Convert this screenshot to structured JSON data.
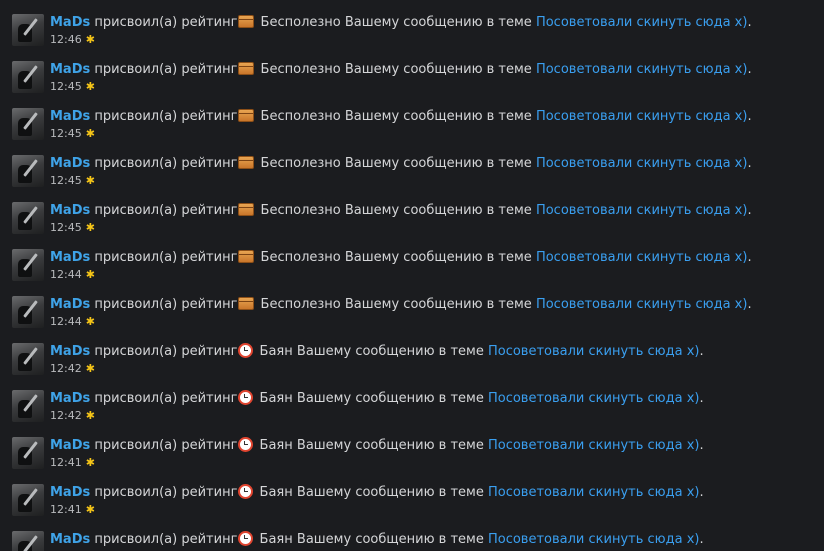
{
  "items": [
    {
      "user": "MaDs",
      "action": "присвоил(а) рейтинг",
      "rating_icon": "box-icon",
      "rating": "Бесполезно",
      "middle": "Вашему сообщению в теме",
      "thread": "Посоветовали скинуть сюда х)",
      "end": ".",
      "time": "12:46"
    },
    {
      "user": "MaDs",
      "action": "присвоил(а) рейтинг",
      "rating_icon": "box-icon",
      "rating": "Бесполезно",
      "middle": "Вашему сообщению в теме",
      "thread": "Посоветовали скинуть сюда х)",
      "end": ".",
      "time": "12:45"
    },
    {
      "user": "MaDs",
      "action": "присвоил(а) рейтинг",
      "rating_icon": "box-icon",
      "rating": "Бесполезно",
      "middle": "Вашему сообщению в теме",
      "thread": "Посоветовали скинуть сюда х)",
      "end": ".",
      "time": "12:45"
    },
    {
      "user": "MaDs",
      "action": "присвоил(а) рейтинг",
      "rating_icon": "box-icon",
      "rating": "Бесполезно",
      "middle": "Вашему сообщению в теме",
      "thread": "Посоветовали скинуть сюда х)",
      "end": ".",
      "time": "12:45"
    },
    {
      "user": "MaDs",
      "action": "присвоил(а) рейтинг",
      "rating_icon": "box-icon",
      "rating": "Бесполезно",
      "middle": "Вашему сообщению в теме",
      "thread": "Посоветовали скинуть сюда х)",
      "end": ".",
      "time": "12:45"
    },
    {
      "user": "MaDs",
      "action": "присвоил(а) рейтинг",
      "rating_icon": "box-icon",
      "rating": "Бесполезно",
      "middle": "Вашему сообщению в теме",
      "thread": "Посоветовали скинуть сюда х)",
      "end": ".",
      "time": "12:44"
    },
    {
      "user": "MaDs",
      "action": "присвоил(а) рейтинг",
      "rating_icon": "box-icon",
      "rating": "Бесполезно",
      "middle": "Вашему сообщению в теме",
      "thread": "Посоветовали скинуть сюда х)",
      "end": ".",
      "time": "12:44"
    },
    {
      "user": "MaDs",
      "action": "присвоил(а) рейтинг",
      "rating_icon": "alarm-clock-icon",
      "rating": "Баян",
      "middle": "Вашему сообщению в теме",
      "thread": "Посоветовали скинуть сюда х)",
      "end": ".",
      "time": "12:42"
    },
    {
      "user": "MaDs",
      "action": "присвоил(а) рейтинг",
      "rating_icon": "alarm-clock-icon",
      "rating": "Баян",
      "middle": "Вашему сообщению в теме",
      "thread": "Посоветовали скинуть сюда х)",
      "end": ".",
      "time": "12:42"
    },
    {
      "user": "MaDs",
      "action": "присвоил(а) рейтинг",
      "rating_icon": "alarm-clock-icon",
      "rating": "Баян",
      "middle": "Вашему сообщению в теме",
      "thread": "Посоветовали скинуть сюда х)",
      "end": ".",
      "time": "12:41"
    },
    {
      "user": "MaDs",
      "action": "присвоил(а) рейтинг",
      "rating_icon": "alarm-clock-icon",
      "rating": "Баян",
      "middle": "Вашему сообщению в теме",
      "thread": "Посоветовали скинуть сюда х)",
      "end": ".",
      "time": "12:41"
    },
    {
      "user": "MaDs",
      "action": "присвоил(а) рейтинг",
      "rating_icon": "alarm-clock-icon",
      "rating": "Баян",
      "middle": "Вашему сообщению в теме",
      "thread": "Посоветовали скинуть сюда х)",
      "end": ".",
      "time": ""
    }
  ],
  "unread_marker": "✱",
  "colors": {
    "background": "#1b1c1f",
    "text": "#d5d6d8",
    "username": "#3fa3e8",
    "link": "#3a9ff0",
    "timestamp": "#b9babd",
    "marker": "#f5c518"
  }
}
